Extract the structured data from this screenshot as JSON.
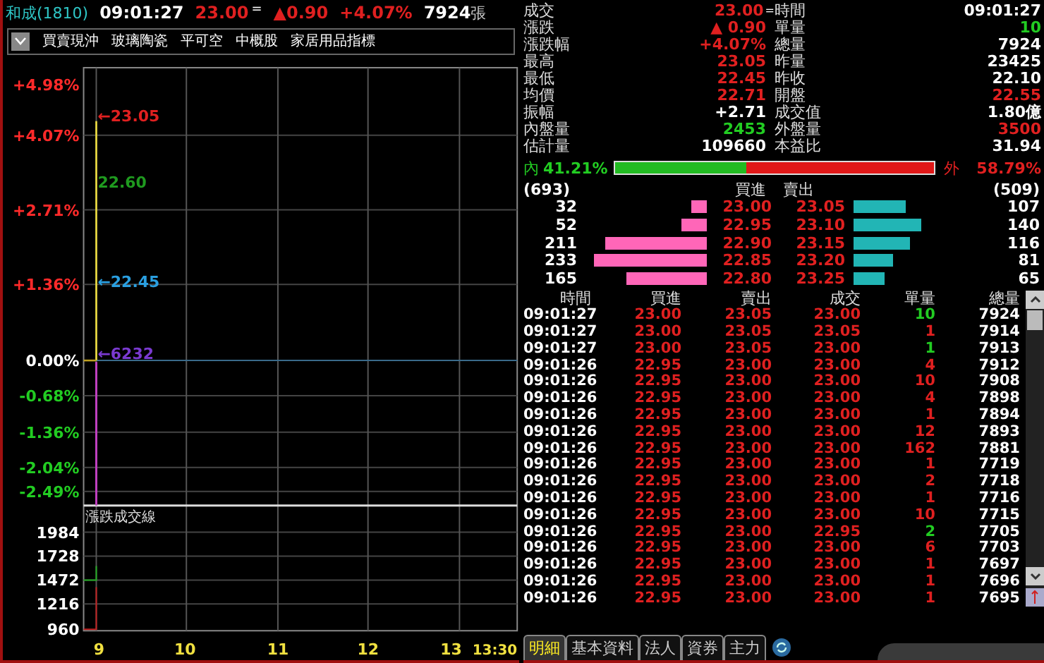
{
  "header": {
    "stock": "和成(1810)",
    "time": "09:01:27",
    "price": "23.00",
    "flat_mark": "=",
    "change": "▲0.90",
    "pct": "+4.07%",
    "volume": "7924",
    "unit": "張"
  },
  "tags": [
    "買賣現沖",
    "玻璃陶瓷",
    "平可空",
    "中概股",
    "家居用品指標"
  ],
  "price_chart": {
    "y_labels": [
      {
        "text": "+4.98%",
        "color": "#ff2a2a"
      },
      {
        "text": "+4.07%",
        "color": "#ff2a2a"
      },
      {
        "text": "+2.71%",
        "color": "#ff2a2a"
      },
      {
        "text": "+1.36%",
        "color": "#ff2a2a"
      },
      {
        "text": "0.00%",
        "color": "#ffffff"
      },
      {
        "text": "-0.68%",
        "color": "#22cc22"
      },
      {
        "text": "-1.36%",
        "color": "#22cc22"
      },
      {
        "text": "-2.04%",
        "color": "#22cc22"
      },
      {
        "text": "-2.49%",
        "color": "#22cc22"
      }
    ],
    "markers": [
      {
        "text": "←23.05",
        "color": "#e02020"
      },
      {
        "text": "22.60",
        "color": "#1f9a1f"
      },
      {
        "text": "←22.45",
        "color": "#2a9fe0"
      },
      {
        "text": "←6232",
        "color": "#7a3ad0"
      }
    ],
    "volume_title": "漲跌成交線",
    "volume_labels": [
      "1984",
      "1728",
      "1472",
      "1216",
      "960"
    ],
    "time_labels": [
      "9",
      "10",
      "11",
      "12",
      "13",
      "13:30"
    ]
  },
  "quote": [
    {
      "label": "成交",
      "value": "23.00",
      "mark": "=",
      "color": "#e02020"
    },
    {
      "label": "時間",
      "value": "09:01:27",
      "color": "#ffffff"
    },
    {
      "label": "漲跌",
      "value": "▲ 0.90",
      "color": "#e02020"
    },
    {
      "label": "單量",
      "value": "10",
      "color": "#22cc22"
    },
    {
      "label": "漲跌幅",
      "value": "+4.07%",
      "color": "#e02020"
    },
    {
      "label": "總量",
      "value": "7924",
      "color": "#ffffff"
    },
    {
      "label": "最高",
      "value": "23.05",
      "color": "#e02020"
    },
    {
      "label": "昨量",
      "value": "23425",
      "color": "#ffffff"
    },
    {
      "label": "最低",
      "value": "22.45",
      "color": "#e02020"
    },
    {
      "label": "昨收",
      "value": "22.10",
      "color": "#ffffff"
    },
    {
      "label": "均價",
      "value": "22.71",
      "color": "#e02020"
    },
    {
      "label": "開盤",
      "value": "22.55",
      "color": "#e02020"
    },
    {
      "label": "振幅",
      "value": "+2.71",
      "color": "#ffffff"
    },
    {
      "label": "成交值",
      "value": "1.80億",
      "color": "#ffffff"
    },
    {
      "label": "內盤量",
      "value": "2453",
      "color": "#22cc22"
    },
    {
      "label": "外盤量",
      "value": "3500",
      "color": "#e02020"
    },
    {
      "label": "估計量",
      "value": "109660",
      "color": "#ffffff"
    },
    {
      "label": "本益比",
      "value": "31.94",
      "color": "#ffffff"
    }
  ],
  "inside": {
    "label": "內",
    "pct": "41.21%",
    "level": 0.4121
  },
  "outside": {
    "label": "外",
    "pct": "58.79%"
  },
  "book": {
    "bid_total": "(693)",
    "bid_title": "買進",
    "ask_title": "賣出",
    "ask_total": "(509)",
    "rows": [
      {
        "bid_qty": "32",
        "bid": "23.00",
        "ask": "23.05",
        "ask_qty": "107"
      },
      {
        "bid_qty": "52",
        "bid": "22.95",
        "ask": "23.10",
        "ask_qty": "140"
      },
      {
        "bid_qty": "211",
        "bid": "22.90",
        "ask": "23.15",
        "ask_qty": "116"
      },
      {
        "bid_qty": "233",
        "bid": "22.85",
        "ask": "23.20",
        "ask_qty": "81"
      },
      {
        "bid_qty": "165",
        "bid": "22.80",
        "ask": "23.25",
        "ask_qty": "65"
      }
    ]
  },
  "trades": {
    "columns": [
      "時間",
      "買進",
      "賣出",
      "成交",
      "單量",
      "總量"
    ],
    "rows": [
      {
        "time": "09:01:27",
        "bid": "23.00",
        "ask": "23.05",
        "price": "23.00",
        "qty": "10",
        "total": "7924",
        "color": "#22cc22"
      },
      {
        "time": "09:01:27",
        "bid": "23.00",
        "ask": "23.05",
        "price": "23.05",
        "qty": "1",
        "total": "7914",
        "color": "#e02020"
      },
      {
        "time": "09:01:27",
        "bid": "23.00",
        "ask": "23.05",
        "price": "23.00",
        "qty": "1",
        "total": "7913",
        "color": "#22cc22"
      },
      {
        "time": "09:01:26",
        "bid": "22.95",
        "ask": "23.00",
        "price": "23.00",
        "qty": "4",
        "total": "7912",
        "color": "#e02020"
      },
      {
        "time": "09:01:26",
        "bid": "22.95",
        "ask": "23.00",
        "price": "23.00",
        "qty": "10",
        "total": "7908",
        "color": "#e02020"
      },
      {
        "time": "09:01:26",
        "bid": "22.95",
        "ask": "23.00",
        "price": "23.00",
        "qty": "4",
        "total": "7898",
        "color": "#e02020"
      },
      {
        "time": "09:01:26",
        "bid": "22.95",
        "ask": "23.00",
        "price": "23.00",
        "qty": "1",
        "total": "7894",
        "color": "#e02020"
      },
      {
        "time": "09:01:26",
        "bid": "22.95",
        "ask": "23.00",
        "price": "23.00",
        "qty": "12",
        "total": "7893",
        "color": "#e02020"
      },
      {
        "time": "09:01:26",
        "bid": "22.95",
        "ask": "23.00",
        "price": "23.00",
        "qty": "162",
        "total": "7881",
        "color": "#e02020"
      },
      {
        "time": "09:01:26",
        "bid": "22.95",
        "ask": "23.00",
        "price": "23.00",
        "qty": "1",
        "total": "7719",
        "color": "#e02020"
      },
      {
        "time": "09:01:26",
        "bid": "22.95",
        "ask": "23.00",
        "price": "23.00",
        "qty": "2",
        "total": "7718",
        "color": "#e02020"
      },
      {
        "time": "09:01:26",
        "bid": "22.95",
        "ask": "23.00",
        "price": "23.00",
        "qty": "1",
        "total": "7716",
        "color": "#e02020"
      },
      {
        "time": "09:01:26",
        "bid": "22.95",
        "ask": "23.00",
        "price": "23.00",
        "qty": "10",
        "total": "7715",
        "color": "#e02020"
      },
      {
        "time": "09:01:26",
        "bid": "22.95",
        "ask": "23.00",
        "price": "22.95",
        "qty": "2",
        "total": "7705",
        "color": "#22cc22"
      },
      {
        "time": "09:01:26",
        "bid": "22.95",
        "ask": "23.00",
        "price": "23.00",
        "qty": "6",
        "total": "7703",
        "color": "#e02020"
      },
      {
        "time": "09:01:26",
        "bid": "22.95",
        "ask": "23.00",
        "price": "23.00",
        "qty": "1",
        "total": "7697",
        "color": "#e02020"
      },
      {
        "time": "09:01:26",
        "bid": "22.95",
        "ask": "23.00",
        "price": "23.00",
        "qty": "1",
        "total": "7696",
        "color": "#e02020"
      },
      {
        "time": "09:01:26",
        "bid": "22.95",
        "ask": "23.00",
        "price": "23.00",
        "qty": "1",
        "total": "7695",
        "color": "#e02020"
      }
    ]
  },
  "tabs": [
    {
      "label": "明細",
      "selected": true
    },
    {
      "label": "基本資料",
      "selected": false
    },
    {
      "label": "法人",
      "selected": false
    },
    {
      "label": "資券",
      "selected": false
    },
    {
      "label": "主力",
      "selected": false
    }
  ]
}
